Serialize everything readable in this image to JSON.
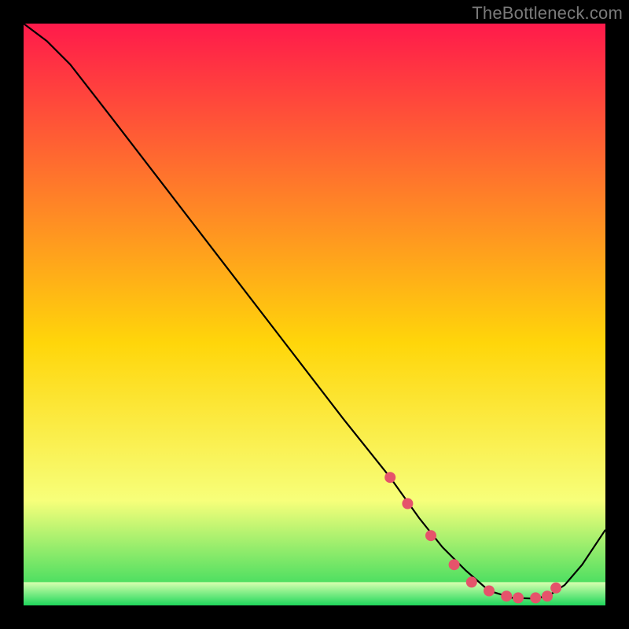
{
  "watermark": "TheBottleneck.com",
  "chart_data": {
    "type": "line",
    "title": "",
    "xlabel": "",
    "ylabel": "",
    "xlim": [
      0,
      100
    ],
    "ylim": [
      0,
      100
    ],
    "grid": false,
    "series": [
      {
        "name": "curve",
        "x": [
          0,
          4,
          8,
          15,
          25,
          35,
          45,
          55,
          63,
          68,
          72,
          76,
          80,
          84,
          87,
          90,
          93,
          96,
          100
        ],
        "y": [
          100,
          97,
          93,
          84,
          71,
          58,
          45,
          32,
          22,
          15,
          10,
          6,
          2.5,
          1.3,
          1.2,
          1.5,
          3.5,
          7,
          13
        ]
      }
    ],
    "markers": {
      "name": "highlight-points",
      "x": [
        63,
        66,
        70,
        74,
        77,
        80,
        83,
        85,
        88,
        90,
        91.5
      ],
      "y": [
        22,
        17.5,
        12,
        7,
        4,
        2.5,
        1.6,
        1.3,
        1.3,
        1.6,
        3.0
      ]
    },
    "gradient_colors": {
      "top": "#ff1a4b",
      "upper": "#ff7a2a",
      "mid": "#ffd60a",
      "lower": "#f7ff7a",
      "bottom": "#1fd65b"
    },
    "bottom_band_y_fraction": 0.04
  }
}
